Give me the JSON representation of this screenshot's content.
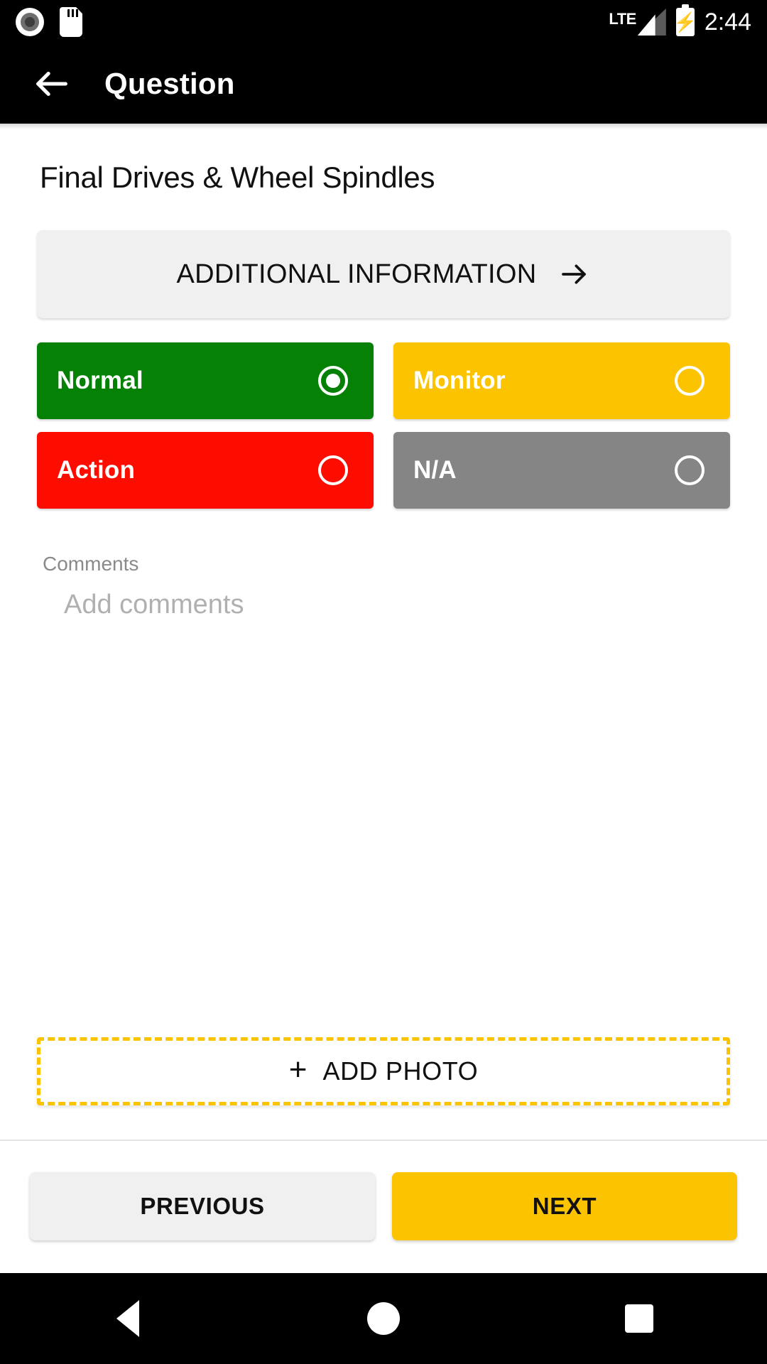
{
  "status_bar": {
    "record_icon": "record-indicator-icon",
    "sdcard_icon": "sd-card-icon",
    "network_type": "LTE",
    "battery_icon": "battery-charging-icon",
    "time": "2:44"
  },
  "app_bar": {
    "back_icon": "back-arrow-icon",
    "title": "Question"
  },
  "main": {
    "section_title": "Final Drives & Wheel Spindles",
    "additional_information": {
      "label": "ADDITIONAL INFORMATION",
      "arrow_icon": "arrow-right-icon"
    },
    "status_options": [
      {
        "label": "Normal",
        "color": "#058205",
        "selected": true
      },
      {
        "label": "Monitor",
        "color": "#fcc400",
        "selected": false
      },
      {
        "label": "Action",
        "color": "#fc0d00",
        "selected": false
      },
      {
        "label": "N/A",
        "color": "#858585",
        "selected": false
      }
    ],
    "comments": {
      "label": "Comments",
      "value": "",
      "placeholder": "Add comments"
    },
    "add_photo": {
      "plus_icon": "plus-icon",
      "label": "ADD PHOTO",
      "border_color": "#fcc400"
    }
  },
  "footer": {
    "previous_label": "PREVIOUS",
    "next_label": "NEXT",
    "next_color": "#fcc400"
  },
  "android_nav": {
    "back_icon": "nav-back-triangle-icon",
    "home_icon": "nav-home-circle-icon",
    "recents_icon": "nav-recents-square-icon"
  }
}
